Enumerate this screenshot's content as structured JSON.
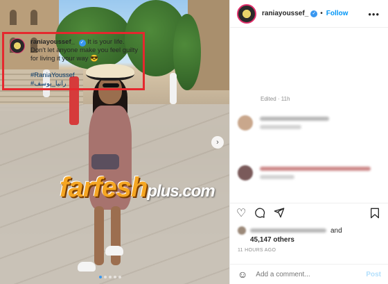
{
  "post": {
    "username": "raniayoussef_",
    "follow_label": "Follow",
    "more_label": "•••",
    "caption_username": "raniayoussef_",
    "caption_text": "It is your life. Don't let anyone make you feel guilty for living it your way",
    "caption_emoji": "😎",
    "hashtag_en": "#RaniaYoussef",
    "hashtag_ar": "#رانيا_يوسف",
    "edited": "Edited · 11h",
    "likes_and": "and",
    "likes_count": "45,147 others",
    "time_ago": "11 HOURS AGO",
    "add_comment_placeholder": "Add a comment...",
    "post_label": "Post"
  },
  "watermark": {
    "main": "farfesh",
    "suffix": "plus.com"
  },
  "icons": {
    "heart": "heart-icon",
    "comment": "comment-icon",
    "share": "share-icon",
    "bookmark": "bookmark-icon",
    "emoji": "emoji-icon",
    "next": "chevron-right-icon"
  },
  "colors": {
    "accent": "#0095f6",
    "highlight_border": "#e5282e",
    "hashtag": "#00376b",
    "watermark": "#f5a623"
  }
}
